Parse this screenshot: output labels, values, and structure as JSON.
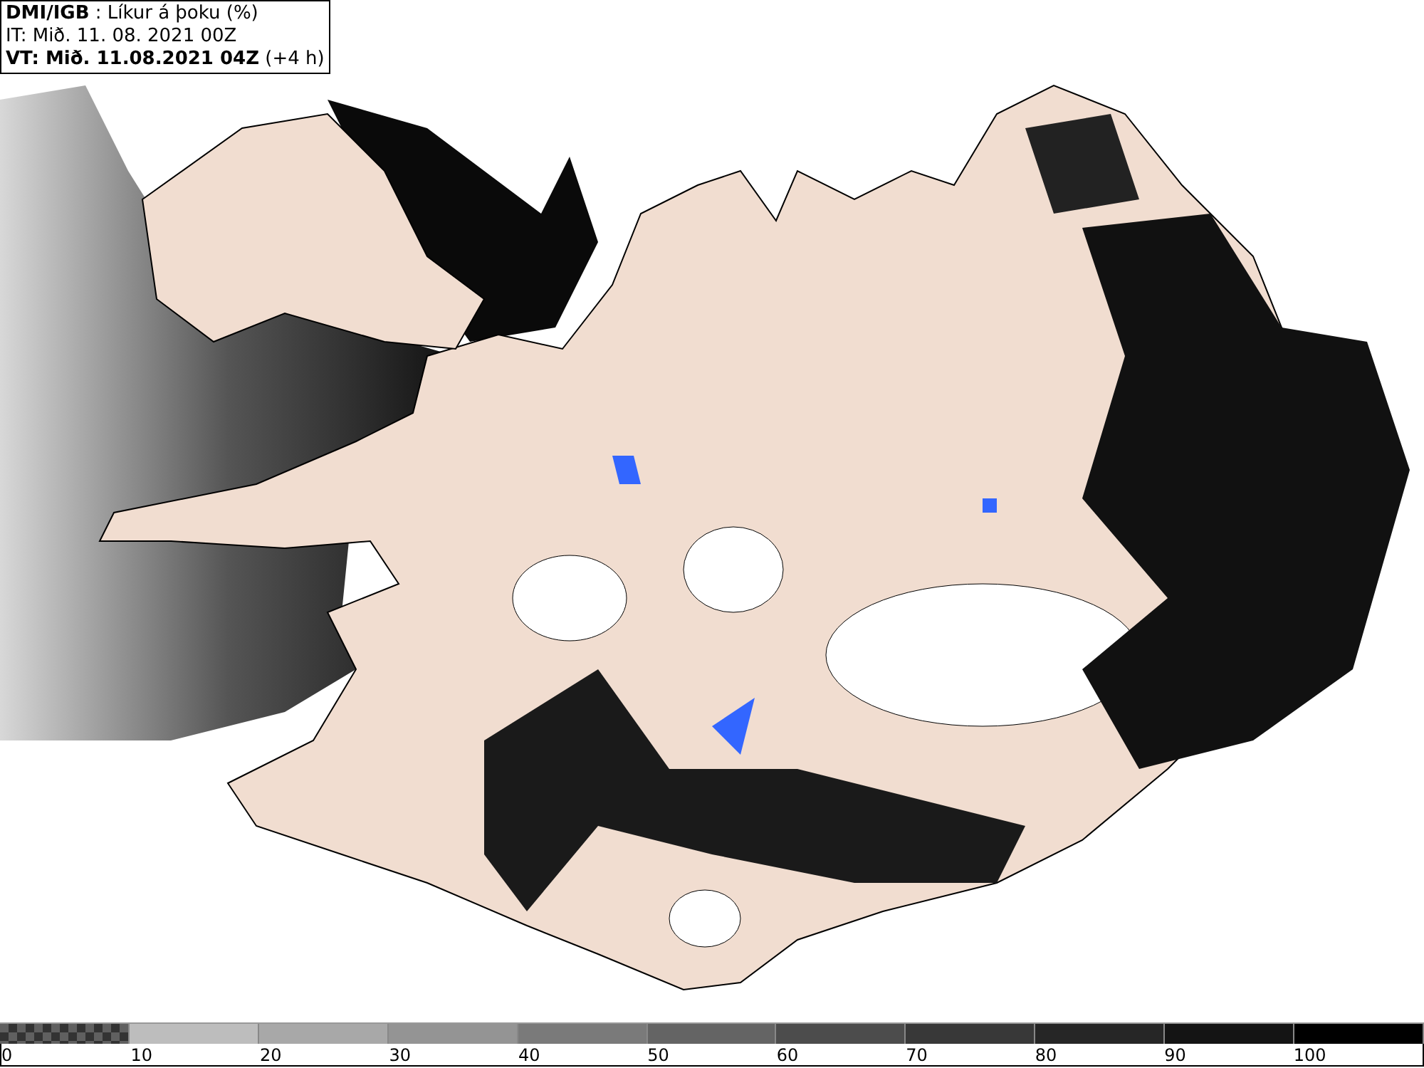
{
  "header": {
    "lines": [
      "**DMI/IGB** : Líkur á þoku (%)",
      "IT: Mið. 11. 08. 2021 00Z",
      "**VT: Mið. 11.08.2021 04Z** (+4 h)"
    ]
  },
  "legend": [
    {
      "label": "0",
      "kind": "checker",
      "color": "#606060"
    },
    {
      "label": "10",
      "kind": "solid",
      "color": "#bdbdbd"
    },
    {
      "label": "20",
      "kind": "solid",
      "color": "#a8a8a8"
    },
    {
      "label": "30",
      "kind": "solid",
      "color": "#949494"
    },
    {
      "label": "40",
      "kind": "solid",
      "color": "#7a7a7a"
    },
    {
      "label": "50",
      "kind": "solid",
      "color": "#646464"
    },
    {
      "label": "60",
      "kind": "solid",
      "color": "#4c4c4c"
    },
    {
      "label": "70",
      "kind": "solid",
      "color": "#383838"
    },
    {
      "label": "80",
      "kind": "solid",
      "color": "#262626"
    },
    {
      "label": "90",
      "kind": "solid",
      "color": "#141414"
    },
    {
      "label": "100",
      "kind": "solid",
      "color": "#000000"
    }
  ]
}
